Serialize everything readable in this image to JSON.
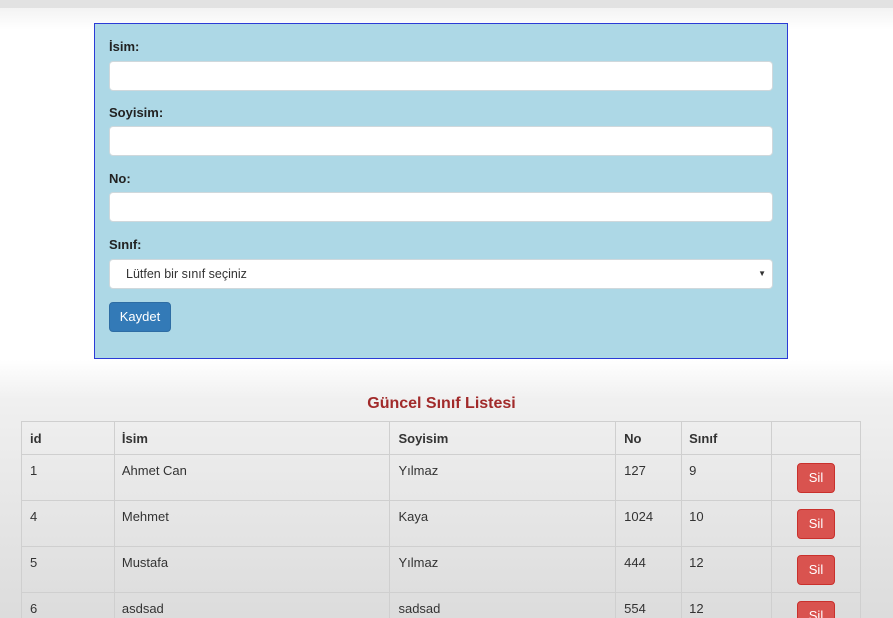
{
  "form": {
    "isim_label": "İsim:",
    "isim_value": "",
    "soyisim_label": "Soyisim:",
    "soyisim_value": "",
    "no_label": "No:",
    "no_value": "",
    "sinif_label": "Sınıf:",
    "sinif_selected": "Lütfen bir sınıf seçiniz",
    "save_label": "Kaydet"
  },
  "list": {
    "title": "Güncel Sınıf Listesi",
    "columns": [
      "id",
      "İsim",
      "Soyisim",
      "No",
      "Sınıf",
      ""
    ],
    "rows": [
      {
        "id": "1",
        "isim": "Ahmet Can",
        "soyisim": "Yılmaz",
        "no": "127",
        "sinif": "9",
        "action": "Sil"
      },
      {
        "id": "4",
        "isim": "Mehmet",
        "soyisim": "Kaya",
        "no": "1024",
        "sinif": "10",
        "action": "Sil"
      },
      {
        "id": "5",
        "isim": "Mustafa",
        "soyisim": "Yılmaz",
        "no": "444",
        "sinif": "12",
        "action": "Sil"
      },
      {
        "id": "6",
        "isim": "asdsad",
        "soyisim": "sadsad",
        "no": "554",
        "sinif": "12",
        "action": "Sil"
      }
    ]
  },
  "colors": {
    "panel_bg": "#add8e6",
    "panel_border": "#2b3bd6",
    "primary_button": "#337ab7",
    "danger_button": "#d9534f",
    "title_color": "#a12a2a"
  }
}
